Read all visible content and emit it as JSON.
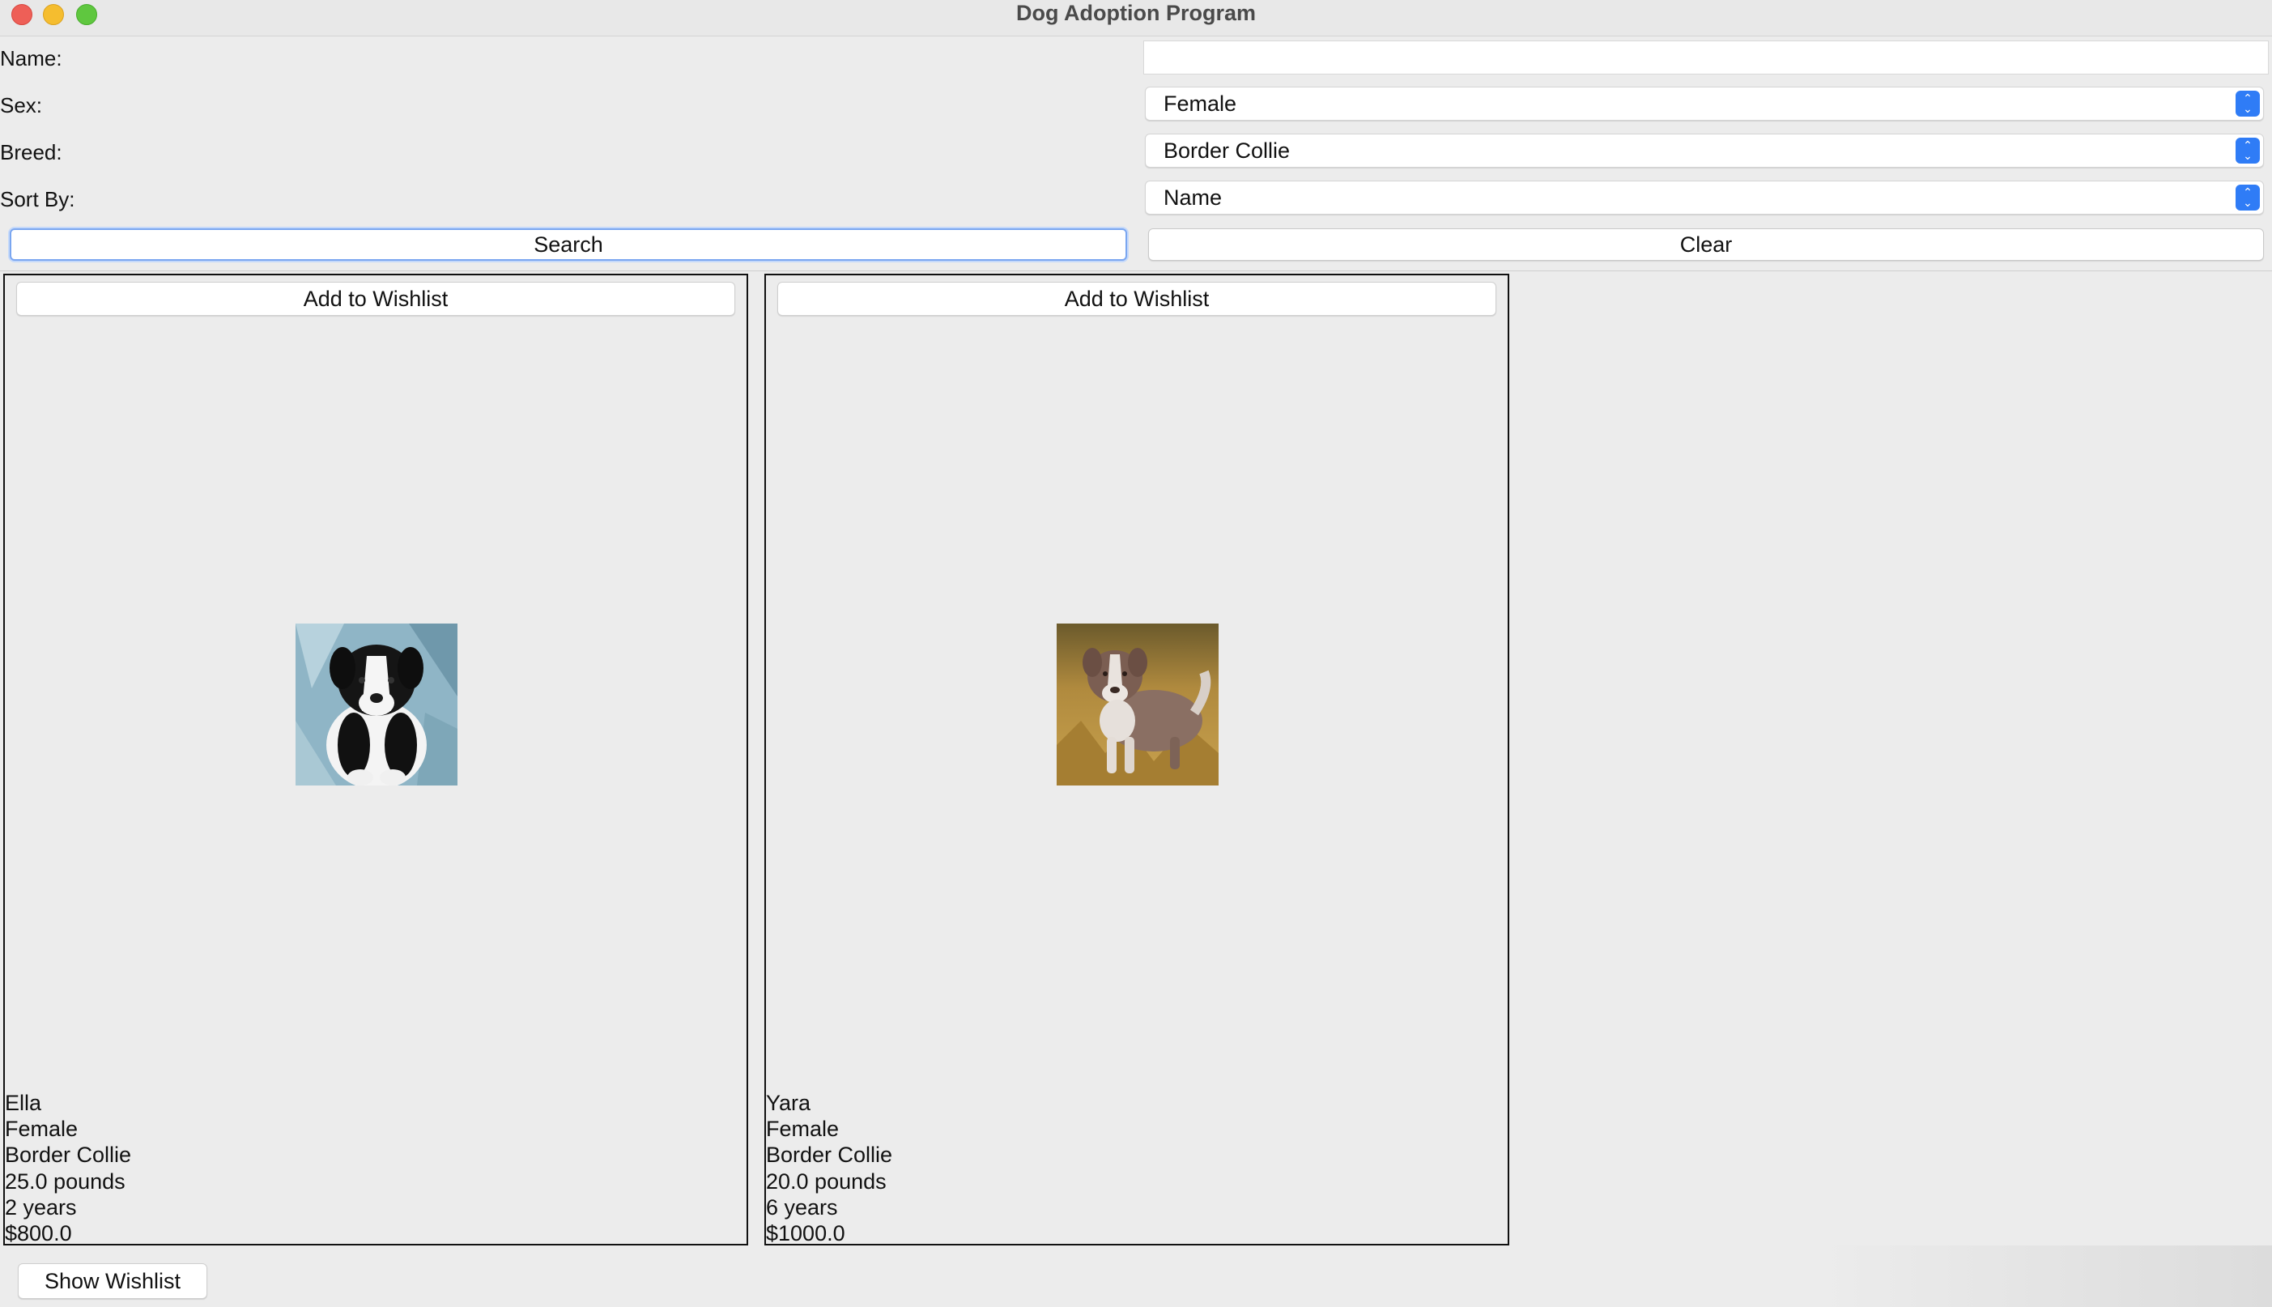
{
  "window": {
    "title": "Dog Adoption Program"
  },
  "form": {
    "name_label": "Name:",
    "name_value": "",
    "sex_label": "Sex:",
    "sex_value": "Female",
    "breed_label": "Breed:",
    "breed_value": "Border Collie",
    "sort_label": "Sort By:",
    "sort_value": "Name",
    "search_label": "Search",
    "clear_label": "Clear"
  },
  "results": [
    {
      "wishlist_label": "Add to Wishlist",
      "name": "Ella",
      "sex": "Female",
      "breed": "Border Collie",
      "weight": "25.0 pounds",
      "age": "2 years",
      "price": "$800.0",
      "photo": "black-white-puppy"
    },
    {
      "wishlist_label": "Add to Wishlist",
      "name": "Yara",
      "sex": "Female",
      "breed": "Border Collie",
      "weight": "20.0 pounds",
      "age": "6 years",
      "price": "$1000.0",
      "photo": "brown-white-puppy"
    }
  ],
  "footer": {
    "show_wishlist_label": "Show Wishlist"
  }
}
